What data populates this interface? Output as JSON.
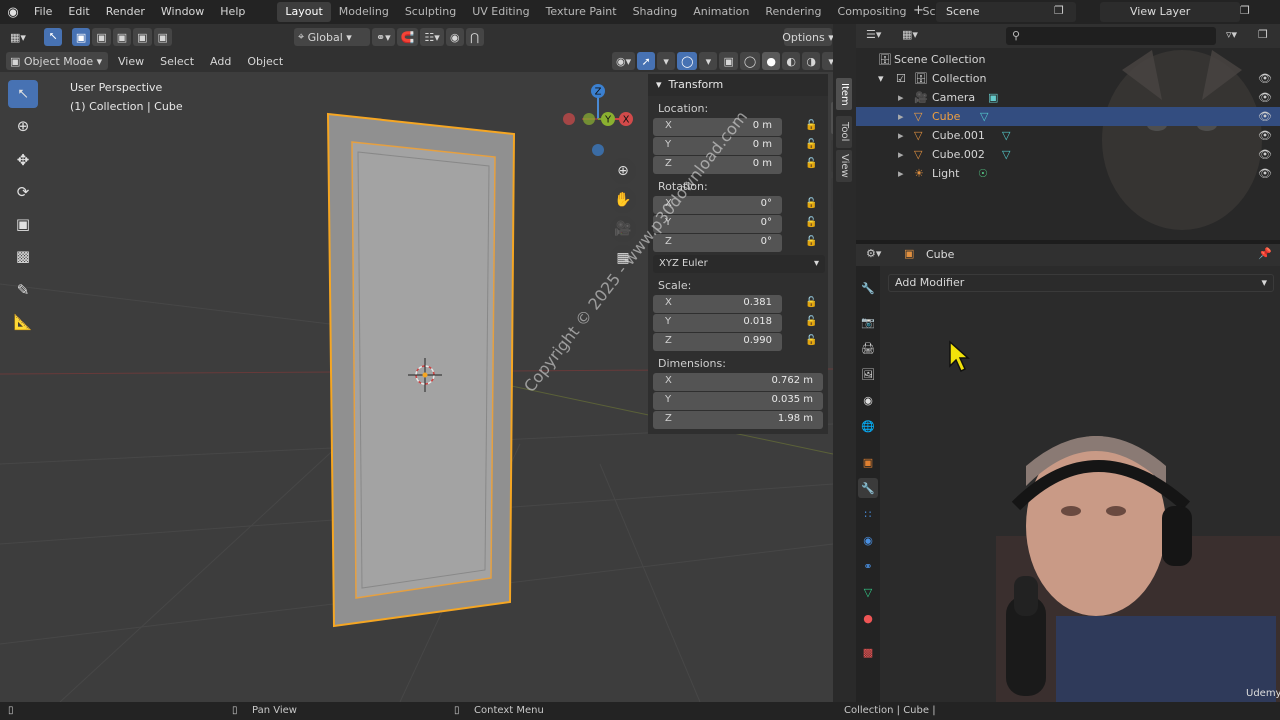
{
  "topbar": {
    "menus": [
      "File",
      "Edit",
      "Render",
      "Window",
      "Help"
    ],
    "workspaces": [
      "Layout",
      "Modeling",
      "Sculpting",
      "UV Editing",
      "Texture Paint",
      "Shading",
      "Animation",
      "Rendering",
      "Compositing",
      "Scripting"
    ],
    "active_workspace": "Layout",
    "scene": "Scene",
    "view_layer": "View Layer"
  },
  "viewport": {
    "header": {
      "orientation": "Global",
      "options": "Options",
      "mode": "Object Mode",
      "menus": [
        "View",
        "Select",
        "Add",
        "Object"
      ]
    },
    "info_line1": "User Perspective",
    "info_line2": "(1) Collection | Cube",
    "gizmo_axes": {
      "x": "X",
      "y": "Y",
      "z": "Z"
    }
  },
  "npanel": {
    "title": "Transform",
    "location_label": "Location:",
    "location": [
      {
        "axis": "X",
        "value": "0 m"
      },
      {
        "axis": "Y",
        "value": "0 m"
      },
      {
        "axis": "Z",
        "value": "0 m"
      }
    ],
    "rotation_label": "Rotation:",
    "rotation": [
      {
        "axis": "X",
        "value": "0°"
      },
      {
        "axis": "Y",
        "value": "0°"
      },
      {
        "axis": "Z",
        "value": "0°"
      }
    ],
    "rotation_mode": "XYZ Euler",
    "scale_label": "Scale:",
    "scale": [
      {
        "axis": "X",
        "value": "0.381"
      },
      {
        "axis": "Y",
        "value": "0.018"
      },
      {
        "axis": "Z",
        "value": "0.990"
      }
    ],
    "dimensions_label": "Dimensions:",
    "dimensions": [
      {
        "axis": "X",
        "value": "0.762 m"
      },
      {
        "axis": "Y",
        "value": "0.035 m"
      },
      {
        "axis": "Z",
        "value": "1.98 m"
      }
    ],
    "tabs": [
      "Item",
      "Tool",
      "View"
    ]
  },
  "outliner": {
    "items": [
      {
        "label": "Scene Collection"
      },
      {
        "label": "Collection"
      },
      {
        "label": "Camera"
      },
      {
        "label": "Cube"
      },
      {
        "label": "Cube.001"
      },
      {
        "label": "Cube.002"
      },
      {
        "label": "Light"
      }
    ]
  },
  "properties": {
    "object_name": "Cube",
    "add_modifier": "Add Modifier"
  },
  "statusbar": {
    "pan_view": "Pan View",
    "context_menu": "Context Menu",
    "right_info": "Collection | Cube |"
  },
  "watermark": "Copyright © 2025 - www.p30download.com",
  "udemy": "Udemy",
  "colors": {
    "accent": "#4772b3",
    "selection_outline": "#f5a623",
    "viewport_bg": "#3d3d3d"
  }
}
